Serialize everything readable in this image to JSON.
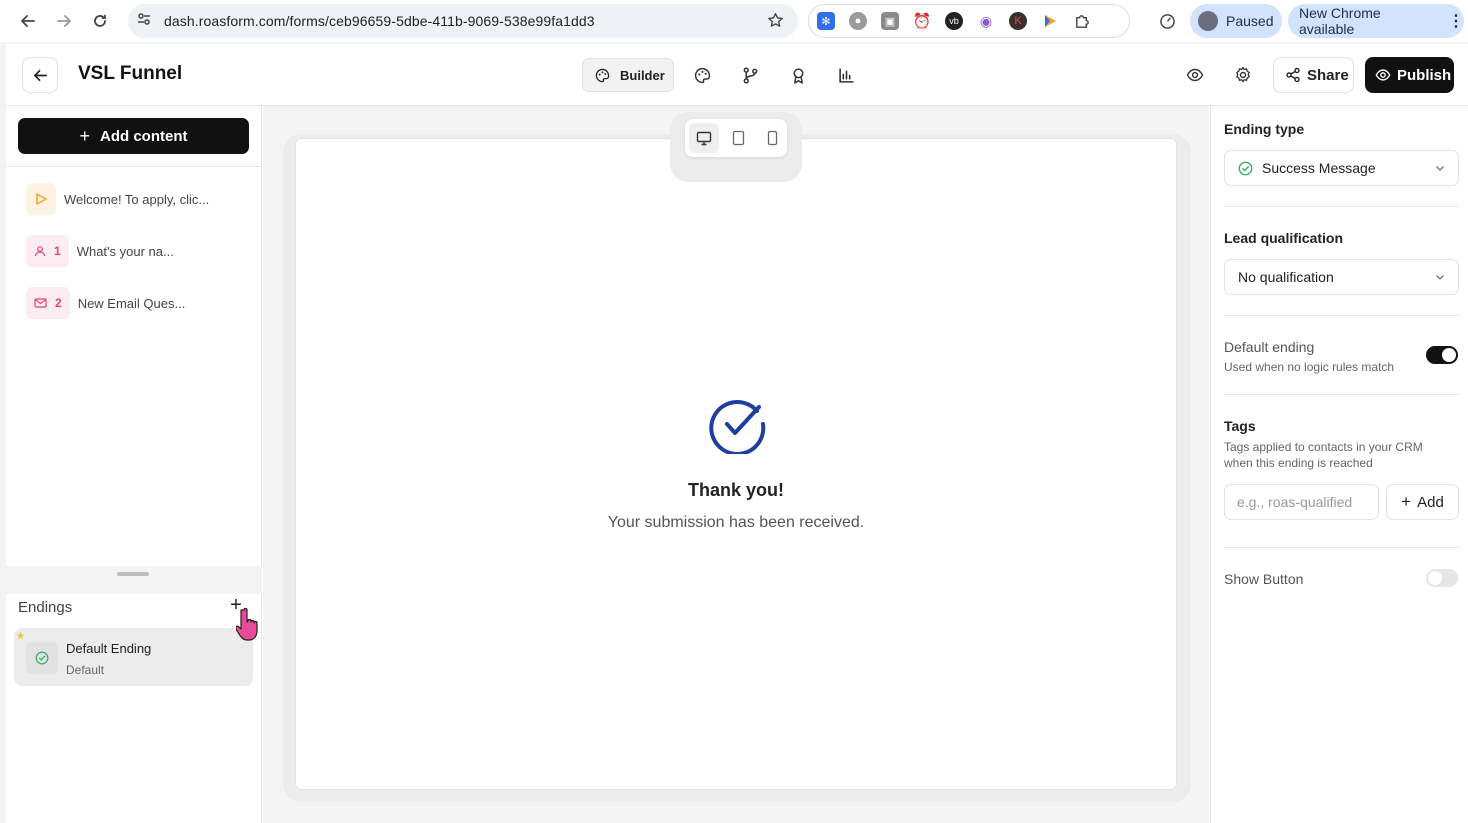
{
  "browser": {
    "url": "dash.roasform.com/forms/ceb96659-5dbe-411b-9069-538e99fa1dd3",
    "profile_status": "Paused",
    "update_label": "New Chrome available"
  },
  "header": {
    "title": "VSL Funnel",
    "builder_label": "Builder",
    "share_label": "Share",
    "publish_label": "Publish"
  },
  "sidebar": {
    "add_content_label": "Add content",
    "items": [
      {
        "number": "",
        "text": "Welcome! To apply, clic...",
        "icon": "play-icon",
        "color": "#f5a623"
      },
      {
        "number": "1",
        "text": "What's your na...",
        "icon": "user-icon",
        "color": "#e0457b"
      },
      {
        "number": "2",
        "text": "New Email Ques...",
        "icon": "mail-icon",
        "color": "#e0457b"
      }
    ],
    "endings_label": "Endings",
    "endings": [
      {
        "name": "Default Ending",
        "sub": "Default"
      }
    ]
  },
  "canvas": {
    "thanks_title": "Thank you!",
    "thanks_sub": "Your submission has been received.",
    "accent_color": "#1f3f9e"
  },
  "panel": {
    "ending_type_label": "Ending type",
    "ending_type_value": "Success Message",
    "lead_label": "Lead qualification",
    "lead_value": "No qualification",
    "default_ending_label": "Default ending",
    "default_ending_desc": "Used when no logic rules match",
    "default_ending_on": true,
    "tags_label": "Tags",
    "tags_desc": "Tags applied to contacts in your CRM when this ending is reached",
    "tags_placeholder": "e.g., roas-qualified",
    "tags_add_label": "Add",
    "show_button_label": "Show Button",
    "show_button_on": false
  }
}
